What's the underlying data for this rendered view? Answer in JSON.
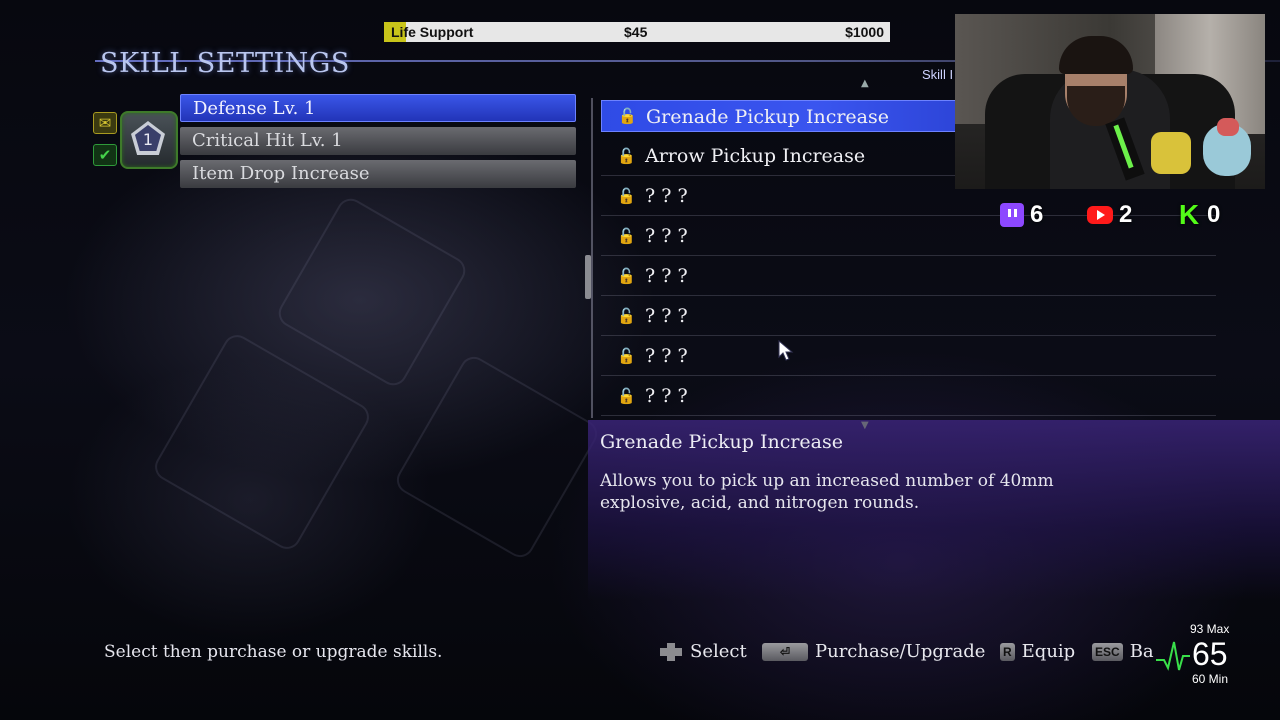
{
  "life_support": {
    "label": "Life Support",
    "current": "$45",
    "goal": "$1000",
    "progress": 0.045
  },
  "screen_title": "SKILL SETTINGS",
  "skill_tab_label": "Skill I",
  "equip_slot_number": "1",
  "equipped_skills": [
    {
      "label": "Defense Lv. 1"
    },
    {
      "label": "Critical Hit Lv. 1"
    },
    {
      "label": "Item Drop Increase"
    }
  ],
  "skill_list": [
    {
      "label": "Grenade Pickup Increase"
    },
    {
      "label": "Arrow Pickup Increase"
    },
    {
      "label": "? ? ?"
    },
    {
      "label": "? ? ?"
    },
    {
      "label": "? ? ?"
    },
    {
      "label": "? ? ?"
    },
    {
      "label": "? ? ?"
    },
    {
      "label": "? ? ?"
    }
  ],
  "description": {
    "title": "Grenade Pickup Increase",
    "text": "Allows you to pick up an increased number of 40mm explosive, acid, and nitrogen rounds."
  },
  "social": {
    "twitch": "6",
    "youtube": "2",
    "kick": "0"
  },
  "footer": {
    "hint": "Select then purchase or upgrade skills.",
    "select": "Select",
    "purchase": "Purchase/Upgrade",
    "equip_key": "R",
    "equip": "Equip",
    "back_key": "ESC",
    "back": "Ba"
  },
  "heart_rate": {
    "max": "93 Max",
    "current": "65",
    "min": "60 Min"
  },
  "colors": {
    "accent_blue": "#3a55ef",
    "heart_green": "#39e04a",
    "life_fill": "#c8c41a"
  }
}
